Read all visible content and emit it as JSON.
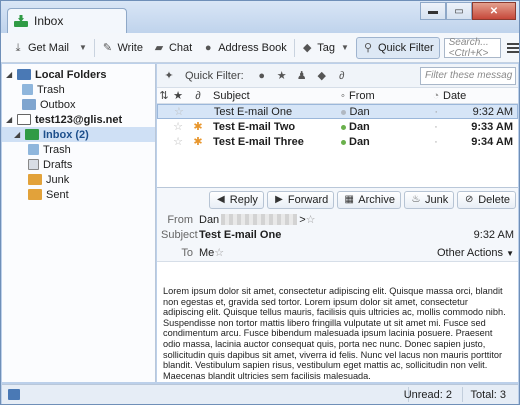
{
  "window": {
    "tab_title": "Inbox",
    "controls": {
      "minimize": "▬",
      "maximize": "▭",
      "close": "✕"
    }
  },
  "toolbar": {
    "get_mail": "Get Mail",
    "write": "Write",
    "chat": "Chat",
    "address_book": "Address Book",
    "tag": "Tag",
    "quick_filter": "Quick Filter",
    "search_placeholder": "Search... <Ctrl+K>"
  },
  "folders": {
    "local_folders": {
      "label": "Local Folders",
      "children": [
        "Trash",
        "Outbox"
      ]
    },
    "account": {
      "label": "test123@glis.net",
      "inbox": "Inbox (2)",
      "children": [
        "Trash",
        "Drafts",
        "Junk",
        "Sent"
      ]
    }
  },
  "quick_filter": {
    "label": "Quick Filter:",
    "search_placeholder": "Filter these messag"
  },
  "columns": {
    "subject": "Subject",
    "from": "From",
    "date": "Date"
  },
  "messages": [
    {
      "subject": "Test E-mail One",
      "from": "Dan",
      "date": "9:32 AM",
      "unread": false
    },
    {
      "subject": "Test E-mail Two",
      "from": "Dan",
      "date": "9:33 AM",
      "unread": true
    },
    {
      "subject": "Test E-mail Three",
      "from": "Dan",
      "date": "9:34 AM",
      "unread": true
    }
  ],
  "message_actions": {
    "reply": "Reply",
    "forward": "Forward",
    "archive": "Archive",
    "junk": "Junk",
    "delete": "Delete"
  },
  "message_header": {
    "from_label": "From",
    "from_name": "Dan",
    "from_email_open": "<",
    "from_email_close": ">",
    "subject_label": "Subject",
    "subject": "Test E-mail One",
    "time": "9:32 AM",
    "to_label": "To",
    "to": "Me",
    "other_actions": "Other Actions"
  },
  "message_body": "Lorem ipsum dolor sit amet, consectetur adipiscing elit. Quisque massa orci, blandit non egestas et, gravida sed tortor. Lorem ipsum dolor sit amet, consectetur adipiscing elit. Quisque tellus mauris, facilisis quis ultricies ac, mollis commodo nibh. Suspendisse non tortor mattis libero fringilla vulputate ut sit amet mi. Fusce sed condimentum arcu. Fusce bibendum malesuada ipsum lacinia posuere. Praesent odio massa, lacinia auctor consequat quis, porta nec nunc. Donec sapien justo, sollicitudin quis dapibus sit amet, viverra id felis. Nunc vel lacus non mauris porttitor blandit. Vestibulum sapien risus, vestibulum eget mattis ac, sollicitudin non velit. Maecenas blandit ultricies sem facilisis malesuada.",
  "status": {
    "unread": "Unread: 2",
    "total": "Total: 3"
  },
  "colors": {
    "accent": "#2f7fd0",
    "inbox_selected": "#cfe0f5",
    "unread_star": "#e8962c",
    "online_dot": "#6ab04c"
  }
}
